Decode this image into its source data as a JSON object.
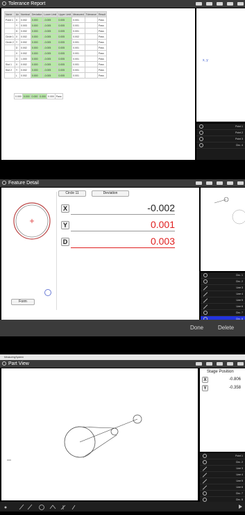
{
  "tolerance": {
    "title": "Tolerance Report",
    "headers": [
      "Name",
      "Ax",
      "Nominal",
      "Deviation",
      "Lower Limit",
      "Upper Limit",
      "Measured",
      "Tolerance",
      "Result"
    ],
    "rows": [
      [
        "Point 1",
        "X",
        "0.002",
        "0.000",
        "-0.005",
        "0.005",
        "0.001",
        "",
        "Pass"
      ],
      [
        "",
        "Y",
        "0.003",
        "0.000",
        "-0.005",
        "0.005",
        "0.001",
        "",
        "Pass"
      ],
      [
        "",
        "D",
        "0.002",
        "0.000",
        "-0.005",
        "0.005",
        "0.001",
        "",
        "Pass"
      ],
      [
        "Circle 1",
        "X",
        "0.002",
        "0.000",
        "-0.005",
        "0.005",
        "0.002",
        "",
        "Pass"
      ],
      [
        "Circle 2",
        "Y",
        "0.002",
        "0.000",
        "-0.005",
        "0.005",
        "0.001",
        "",
        "Pass"
      ],
      [
        "",
        "D",
        "0.002",
        "0.000",
        "-0.005",
        "0.005",
        "0.001",
        "",
        "Pass"
      ],
      [
        "",
        "X",
        "0.002",
        "0.000",
        "-0.005",
        "0.005",
        "0.001",
        "",
        "Pass"
      ],
      [
        "",
        "D",
        "1.000",
        "0.000",
        "-0.005",
        "0.005",
        "0.001",
        "",
        "Pass"
      ],
      [
        "Slot 1",
        "X",
        "0.002",
        "0.000",
        "-0.005",
        "0.005",
        "0.001",
        "",
        "Pass"
      ],
      [
        "Slot 2",
        "Y",
        "0.002",
        "0.000",
        "-0.005",
        "0.005",
        "0.001",
        "",
        "Pass"
      ],
      [
        "",
        "L",
        "0.002",
        "0.000",
        "-0.005",
        "0.005",
        "0.001",
        "",
        "Pass"
      ]
    ],
    "extra_row": [
      "0.000",
      "0.000",
      "0.000",
      "0.000",
      "0.000",
      "Pass"
    ],
    "right_label": "x, y",
    "list": [
      "Point 1",
      "Point 2",
      "Point 3",
      "Circ. 4"
    ]
  },
  "feature": {
    "title": "Feature Detail",
    "tab1": "Circle 11",
    "tab2": "Deviation",
    "form_label": "Form",
    "axes": [
      {
        "label": "X",
        "value": "-0.002",
        "color": "#222222"
      },
      {
        "label": "Y",
        "value": "0.001",
        "color": "#e02020"
      },
      {
        "label": "D",
        "value": "0.003",
        "color": "#e02020"
      }
    ],
    "list": [
      "Circ. 1",
      "Circ. 2",
      "Line 3",
      "Line 4",
      "Line 5",
      "Line 6",
      "Circ. 7",
      "Circ. 8"
    ],
    "done": "Done",
    "delete": "Delete"
  },
  "part": {
    "window_title": "MeasuringSystem",
    "title": "Part View",
    "stage_title": "Stage Position",
    "x_label": "X",
    "y_label": "Y",
    "x_value": "-0.806",
    "y_value": "-0.358",
    "list": [
      "Point 1",
      "Circ. 2",
      "Line 3",
      "Line 4",
      "Line 5",
      "Line 6",
      "Circ. 7",
      "Circ. 8",
      "Circ. 9"
    ]
  }
}
